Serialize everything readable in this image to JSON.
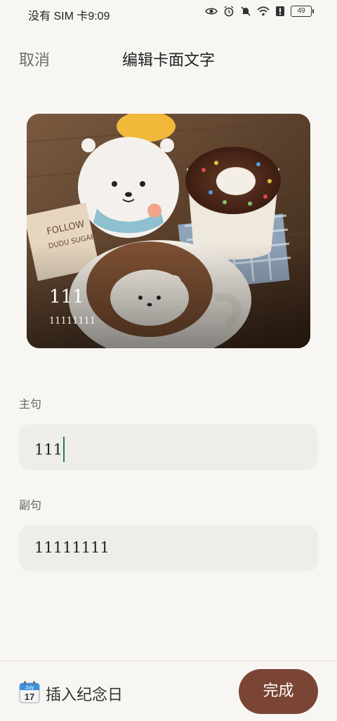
{
  "status": {
    "carrier_time": "没有 SIM 卡9:09",
    "battery": "49"
  },
  "header": {
    "cancel_label": "取消",
    "title": "编辑卡面文字"
  },
  "card": {
    "main_text": "111",
    "sub_text": "11111111"
  },
  "form": {
    "main_label": "主句",
    "main_value": "111",
    "sub_label": "副句",
    "sub_value": "11111111"
  },
  "footer": {
    "calendar_month": "July",
    "calendar_day": "17",
    "insert_label": "插入纪念日",
    "done_label": "完成"
  },
  "colors": {
    "accent": "#7b4536",
    "caret": "#1f7a6a",
    "field_bg": "#efede9",
    "page_bg": "#f8f6f3"
  },
  "icons": [
    "eye-icon",
    "alarm-icon",
    "mute-icon",
    "wifi-icon",
    "alert-icon",
    "battery-icon",
    "calendar-icon"
  ]
}
